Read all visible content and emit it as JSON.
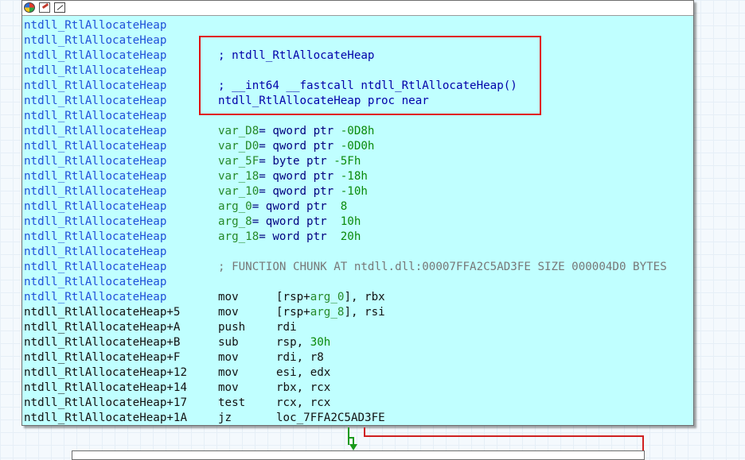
{
  "header": {
    "icons": [
      "color-palette-icon",
      "edit-pencil-icon",
      "graph-layout-icon"
    ]
  },
  "lines": [
    {
      "addr": "ntdll_RtlAllocateHeap",
      "style": "blue"
    },
    {
      "addr": "ntdll_RtlAllocateHeap",
      "style": "blue"
    },
    {
      "addr": "ntdll_RtlAllocateHeap",
      "style": "blue",
      "comment": "; ntdll_RtlAllocateHeap"
    },
    {
      "addr": "ntdll_RtlAllocateHeap",
      "style": "blue"
    },
    {
      "addr": "ntdll_RtlAllocateHeap",
      "style": "blue",
      "comment": "; __int64 __fastcall ntdll_RtlAllocateHeap()"
    },
    {
      "addr": "ntdll_RtlAllocateHeap",
      "style": "blue",
      "comment": "ntdll_RtlAllocateHeap proc near"
    },
    {
      "addr": "ntdll_RtlAllocateHeap",
      "style": "blue"
    },
    {
      "addr": "ntdll_RtlAllocateHeap",
      "style": "blue",
      "var": {
        "name": "var_D8",
        "def": " qword ptr ",
        "val": "-0D8h"
      }
    },
    {
      "addr": "ntdll_RtlAllocateHeap",
      "style": "blue",
      "var": {
        "name": "var_D0",
        "def": " qword ptr ",
        "val": "-0D0h"
      }
    },
    {
      "addr": "ntdll_RtlAllocateHeap",
      "style": "blue",
      "var": {
        "name": "var_5F",
        "def": " byte ptr ",
        "val": "-5Fh"
      }
    },
    {
      "addr": "ntdll_RtlAllocateHeap",
      "style": "blue",
      "var": {
        "name": "var_18",
        "def": " qword ptr ",
        "val": "-18h"
      }
    },
    {
      "addr": "ntdll_RtlAllocateHeap",
      "style": "blue",
      "var": {
        "name": "var_10",
        "def": " qword ptr ",
        "val": "-10h"
      }
    },
    {
      "addr": "ntdll_RtlAllocateHeap",
      "style": "blue",
      "var": {
        "name": "arg_0",
        "def": " qword ptr  ",
        "val": "8"
      }
    },
    {
      "addr": "ntdll_RtlAllocateHeap",
      "style": "blue",
      "var": {
        "name": "arg_8",
        "def": " qword ptr  ",
        "val": "10h"
      }
    },
    {
      "addr": "ntdll_RtlAllocateHeap",
      "style": "blue",
      "var": {
        "name": "arg_18",
        "def": " word ptr  ",
        "val": "20h"
      }
    },
    {
      "addr": "ntdll_RtlAllocateHeap",
      "style": "blue"
    },
    {
      "addr": "ntdll_RtlAllocateHeap",
      "style": "blue",
      "comment": "; FUNCTION CHUNK AT ntdll.dll:00007FFA2C5AD3FE SIZE 000004D0 BYTES",
      "comment_style": "gray"
    },
    {
      "addr": "ntdll_RtlAllocateHeap",
      "style": "blue"
    },
    {
      "addr": "ntdll_RtlAllocateHeap",
      "style": "blue",
      "mn": "mov",
      "ops": [
        {
          "t": "[rsp+"
        },
        {
          "t": "arg_0",
          "c": "var"
        },
        {
          "t": "], rbx"
        }
      ]
    },
    {
      "addr": "ntdll_RtlAllocateHeap+5",
      "style": "black",
      "mn": "mov",
      "ops": [
        {
          "t": "[rsp+"
        },
        {
          "t": "arg_8",
          "c": "var"
        },
        {
          "t": "], rsi"
        }
      ]
    },
    {
      "addr": "ntdll_RtlAllocateHeap+A",
      "style": "black",
      "mn": "push",
      "ops": [
        {
          "t": "rdi"
        }
      ]
    },
    {
      "addr": "ntdll_RtlAllocateHeap+B",
      "style": "black",
      "mn": "sub",
      "ops": [
        {
          "t": "rsp, "
        },
        {
          "t": "30h",
          "c": "val"
        }
      ]
    },
    {
      "addr": "ntdll_RtlAllocateHeap+F",
      "style": "black",
      "mn": "mov",
      "ops": [
        {
          "t": "rdi, r8"
        }
      ]
    },
    {
      "addr": "ntdll_RtlAllocateHeap+12",
      "style": "black",
      "mn": "mov",
      "ops": [
        {
          "t": "esi, edx"
        }
      ]
    },
    {
      "addr": "ntdll_RtlAllocateHeap+14",
      "style": "black",
      "mn": "mov",
      "ops": [
        {
          "t": "rbx, rcx"
        }
      ]
    },
    {
      "addr": "ntdll_RtlAllocateHeap+17",
      "style": "black",
      "mn": "test",
      "ops": [
        {
          "t": "rcx, rcx"
        }
      ]
    },
    {
      "addr": "ntdll_RtlAllocateHeap+1A",
      "style": "black",
      "mn": "jz",
      "ops": [
        {
          "t": "loc_7FFA2C5AD3FE",
          "c": "lbl"
        }
      ]
    }
  ]
}
